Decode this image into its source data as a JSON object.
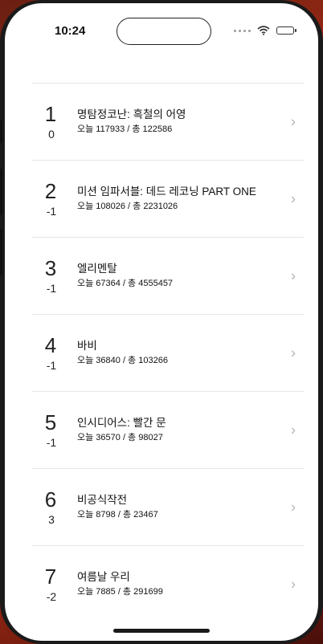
{
  "status_bar": {
    "time": "10:24",
    "icons": [
      "signal-dots-icon",
      "wifi-icon",
      "battery-icon"
    ]
  },
  "movies": [
    {
      "rank": "1",
      "change": "0",
      "title": "명탐정코난: 흑철의 어영",
      "stats": "오늘 117933 / 총 122586"
    },
    {
      "rank": "2",
      "change": "-1",
      "title": "미션 임파서블: 데드 레코닝 PART ONE",
      "stats": "오늘 108026 / 총 2231026"
    },
    {
      "rank": "3",
      "change": "-1",
      "title": "엘리멘탈",
      "stats": "오늘 67364 / 총 4555457"
    },
    {
      "rank": "4",
      "change": "-1",
      "title": "바비",
      "stats": "오늘 36840 / 총 103266"
    },
    {
      "rank": "5",
      "change": "-1",
      "title": "인시디어스: 빨간 문",
      "stats": "오늘 36570 / 총 98027"
    },
    {
      "rank": "6",
      "change": "3",
      "title": "비공식작전",
      "stats": "오늘 8798 / 총 23467"
    },
    {
      "rank": "7",
      "change": "-2",
      "title": "여름날 우리",
      "stats": "오늘 7885 / 총 291699"
    }
  ]
}
